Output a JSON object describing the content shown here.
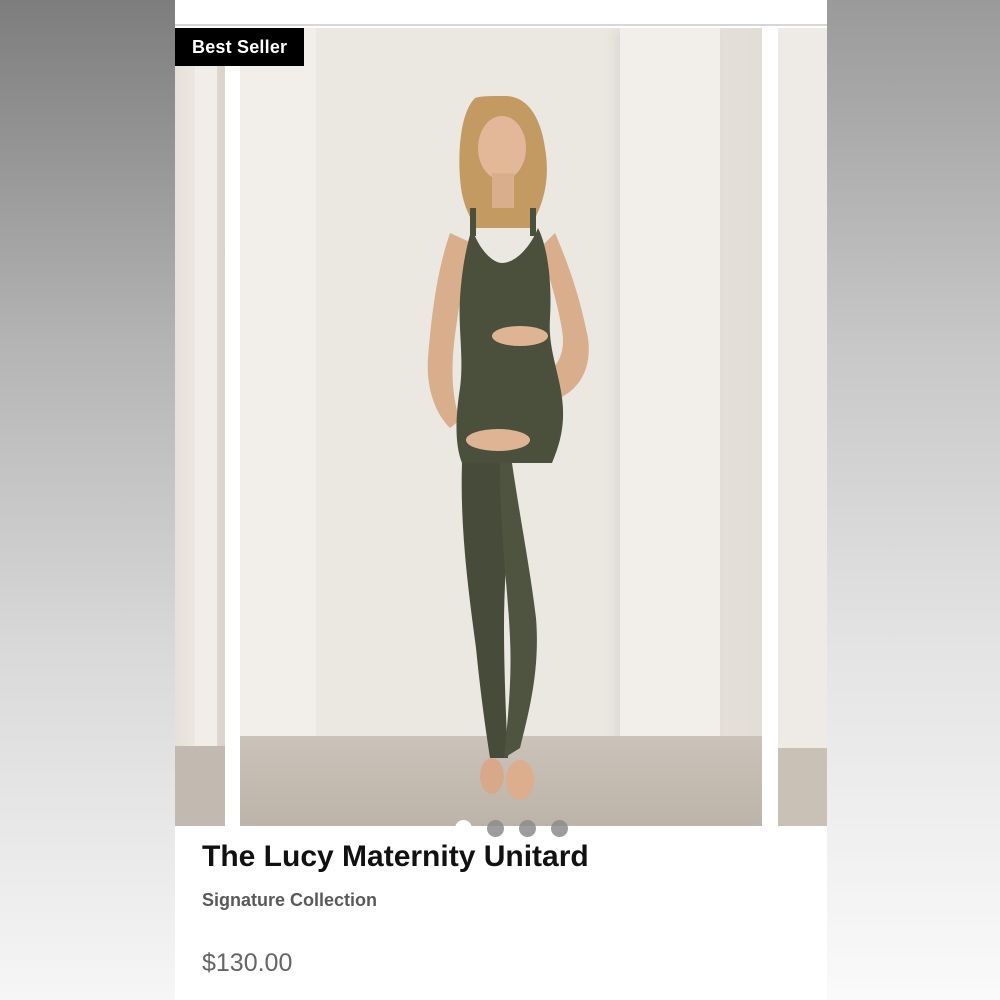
{
  "badge": {
    "label": "Best Seller"
  },
  "product": {
    "title": "The Lucy Maternity Unitard",
    "collection": "Signature Collection",
    "price": "$130.00",
    "color": "#4a4f3c"
  },
  "carousel": {
    "total_slides": 4,
    "active_index": 0
  },
  "colors": {
    "badge_bg": "#000000",
    "badge_text": "#ffffff",
    "garment": "#4b503d"
  }
}
